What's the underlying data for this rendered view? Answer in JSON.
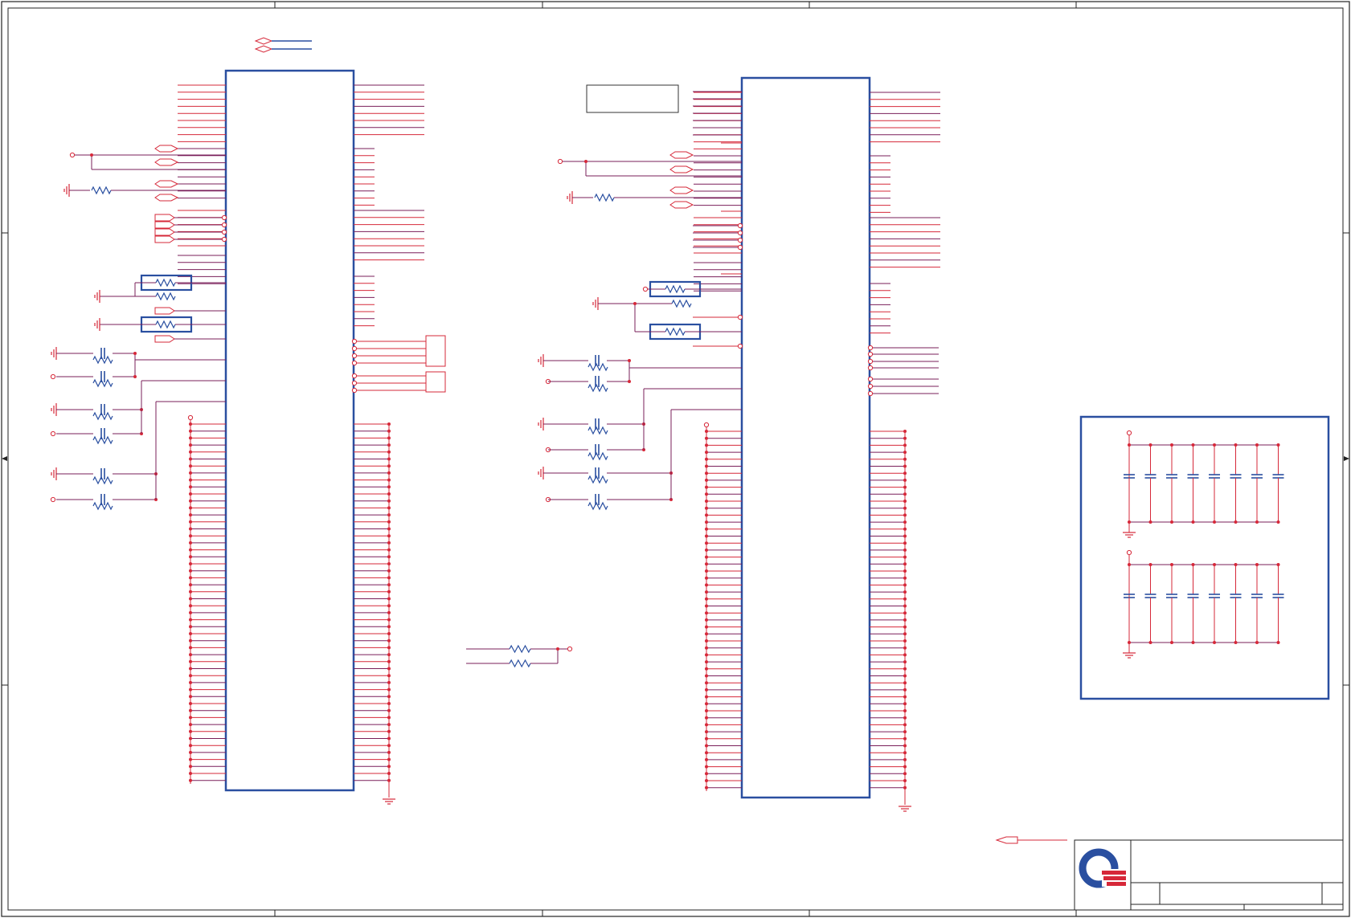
{
  "sheet": {
    "title": "",
    "colors": {
      "border": "#222222",
      "net": "#d62839",
      "wire": "#7a1f5a",
      "part": "#2a4fa0",
      "pin": "#d62839",
      "logo_blue": "#2a4fa0",
      "logo_red": "#d62839"
    },
    "logo": "quanta-logo"
  }
}
